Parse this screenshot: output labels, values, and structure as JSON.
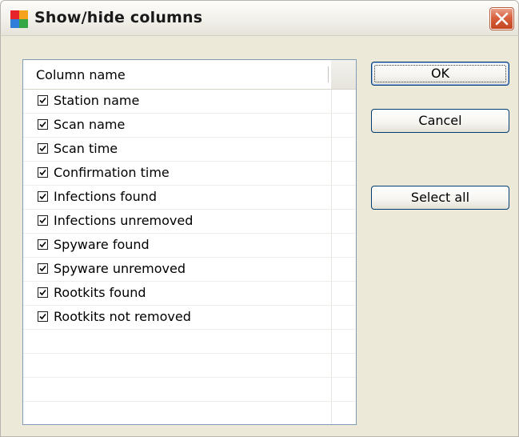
{
  "window": {
    "title": "Show/hide columns",
    "app_icon": "avg-logo-icon",
    "close_icon": "close-icon"
  },
  "listview": {
    "header": "Column name",
    "items": [
      {
        "label": "Station name",
        "checked": true
      },
      {
        "label": "Scan name",
        "checked": true
      },
      {
        "label": "Scan time",
        "checked": true
      },
      {
        "label": "Confirmation time",
        "checked": true
      },
      {
        "label": "Infections found",
        "checked": true
      },
      {
        "label": "Infections unremoved",
        "checked": true
      },
      {
        "label": "Spyware found",
        "checked": true
      },
      {
        "label": "Spyware unremoved",
        "checked": true
      },
      {
        "label": "Rootkits found",
        "checked": true
      },
      {
        "label": "Rootkits not removed",
        "checked": true
      }
    ]
  },
  "buttons": {
    "ok": "OK",
    "cancel": "Cancel",
    "select_all": "Select all"
  },
  "colors": {
    "dialog_background": "#ece9d8",
    "close_button": "#d8603d",
    "button_border": "#003c74"
  }
}
